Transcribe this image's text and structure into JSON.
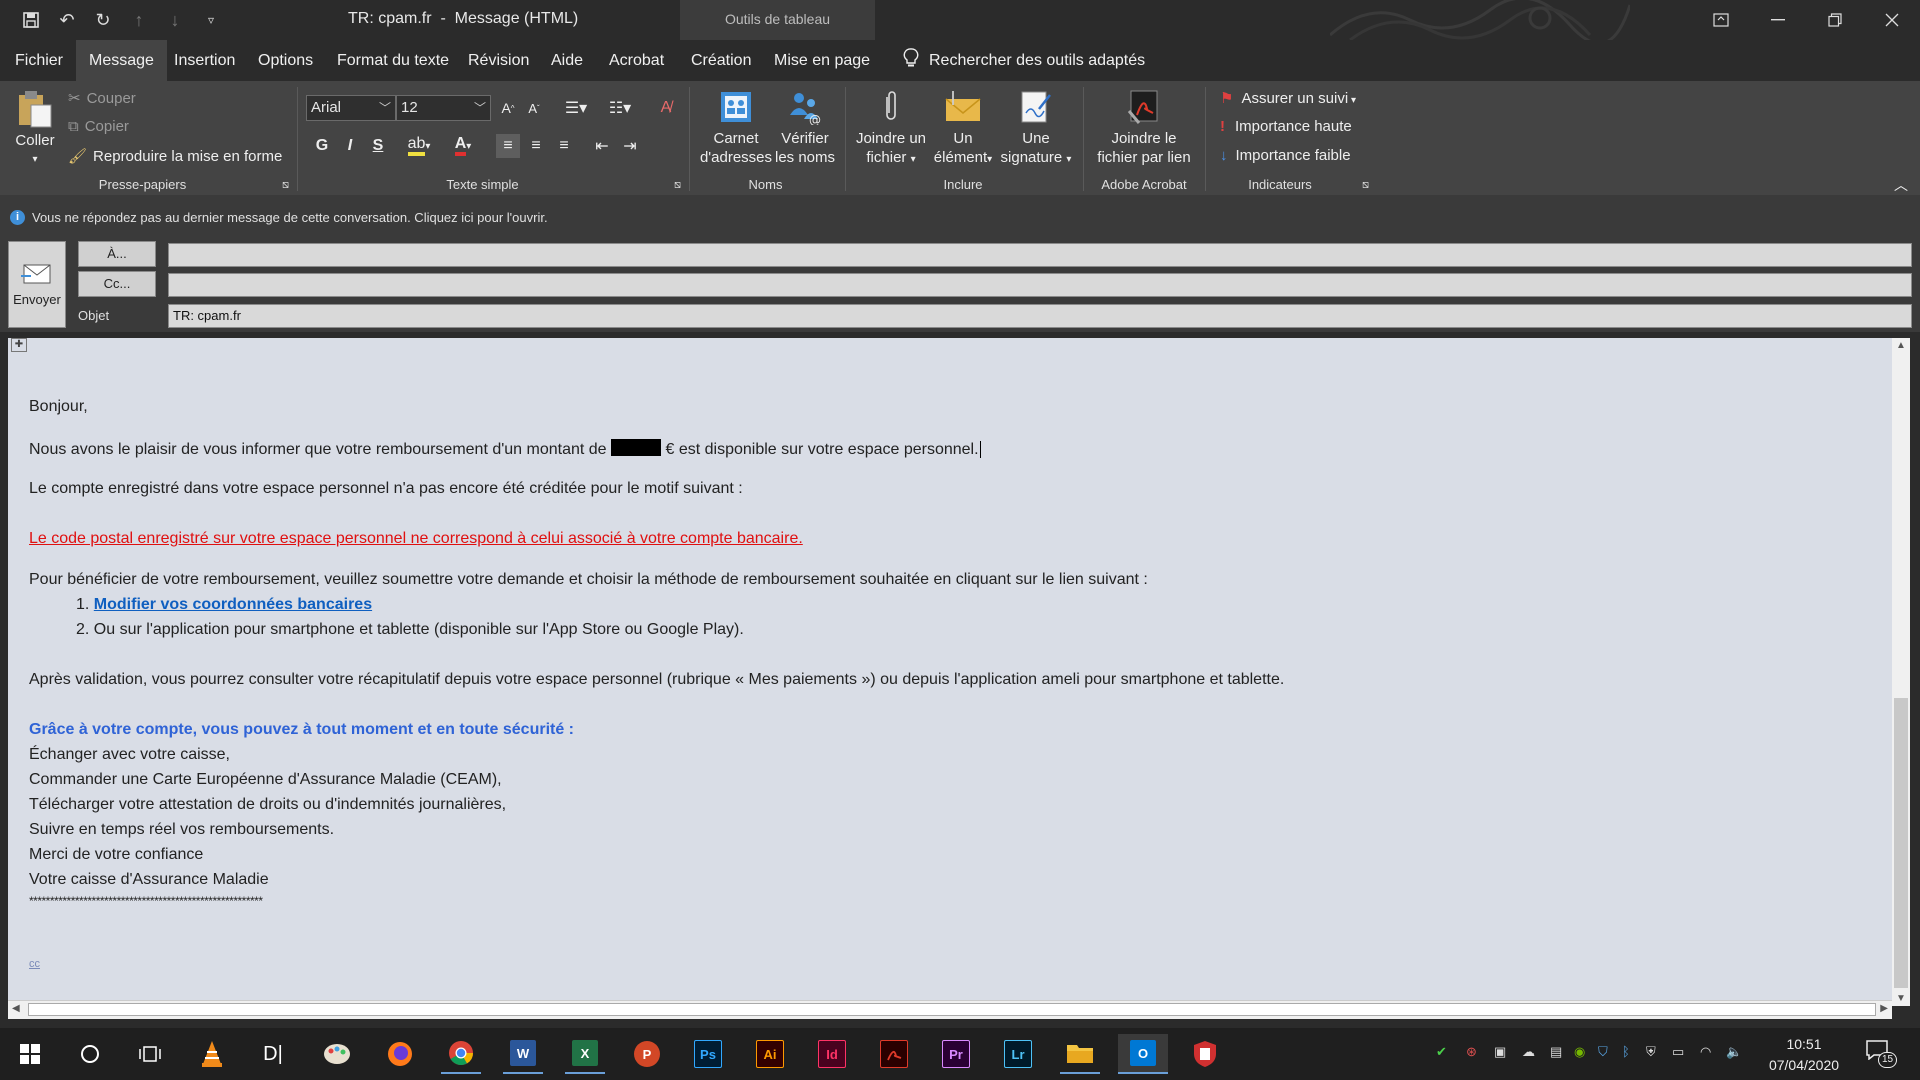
{
  "window": {
    "title": "TR: cpam.fr  -  Message (HTML)",
    "context_tab": "Outils de tableau"
  },
  "tabs": [
    {
      "label": "Fichier"
    },
    {
      "label": "Message"
    },
    {
      "label": "Insertion"
    },
    {
      "label": "Options"
    },
    {
      "label": "Format du texte"
    },
    {
      "label": "Révision"
    },
    {
      "label": "Aide"
    },
    {
      "label": "Acrobat"
    },
    {
      "label": "Création"
    },
    {
      "label": "Mise en page"
    }
  ],
  "search_tools": "Rechercher des outils adaptés",
  "ribbon": {
    "clipboard": {
      "paste": "Coller",
      "cut": "Couper",
      "copy": "Copier",
      "format_painter": "Reproduire la mise en forme",
      "group": "Presse-papiers"
    },
    "basic_text": {
      "font": "Arial",
      "size": "12",
      "bold": "G",
      "italic": "I",
      "underline": "S",
      "group": "Texte simple"
    },
    "names": {
      "address_book": "Carnet d'adresses",
      "address_book_l1": "Carnet",
      "address_book_l2": "d'adresses",
      "check_names_l1": "Vérifier",
      "check_names_l2": "les noms",
      "group": "Noms"
    },
    "include": {
      "attach_l1": "Joindre un",
      "attach_l2": "fichier",
      "item_l1": "Un",
      "item_l2": "élément",
      "signature_l1": "Une",
      "signature_l2": "signature",
      "group": "Inclure"
    },
    "acrobat": {
      "attach_link_l1": "Joindre le",
      "attach_link_l2": "fichier par lien",
      "group": "Adobe Acrobat"
    },
    "tags": {
      "follow_up": "Assurer un suivi",
      "high": "Importance haute",
      "low": "Importance faible",
      "group": "Indicateurs"
    }
  },
  "info_bar": "Vous ne répondez pas au dernier message de cette conversation. Cliquez ici pour l'ouvrir.",
  "headers": {
    "send": "Envoyer",
    "to_button": "À...",
    "cc_button": "Cc...",
    "subject_label": "Objet",
    "to_value": "",
    "cc_value": "",
    "subject_value": "TR: cpam.fr"
  },
  "body": {
    "greeting": "Bonjour,",
    "line1_a": "Nous avons le plaisir de vous informer que votre remboursement d'un montant de ",
    "line1_b": " € est disponible sur votre espace personnel.",
    "line2": "Le compte enregistré dans votre espace personnel n'a pas encore été créditée pour le motif suivant :",
    "warning": "Le code postal enregistré sur votre espace personnel ne correspond à celui associé à votre compte bancaire.",
    "line3": "Pour bénéficier de votre remboursement, veuillez soumettre votre demande et choisir la méthode de remboursement souhaitée en cliquant sur le lien suivant :",
    "list_item1_num": "1.",
    "list_item1": "Modifier vos coordonnées bancaires",
    "list_item2_num": "2.",
    "list_item2": "Ou sur l'application pour smartphone et tablette (disponible sur l'App Store ou Google Play).",
    "line4": "Après validation, vous pourrez consulter votre récapitulatif depuis votre espace personnel (rubrique « Mes paiements ») ou depuis l'application ameli pour smartphone et tablette.",
    "heading": "Grâce à votre compte, vous pouvez à tout moment et en toute sécurité :",
    "b1": "Échanger avec votre caisse,",
    "b2": "Commander une Carte Européenne d'Assurance Maladie (CEAM),",
    "b3": "Télécharger votre attestation de droits ou d'indemnités journalières,",
    "b4": "Suivre en temps réel vos remboursements.",
    "thanks": "Merci de votre confiance",
    "sign": "Votre caisse d'Assurance Maladie",
    "stars": "********************************************************",
    "footer_link": "cc"
  },
  "taskbar": {
    "apps": [
      {
        "name": "vlc",
        "label": ""
      },
      {
        "name": "dl",
        "label": "D|"
      },
      {
        "name": "firefox",
        "label": ""
      },
      {
        "name": "chrome",
        "label": ""
      },
      {
        "name": "word",
        "label": "W"
      },
      {
        "name": "excel",
        "label": "X"
      },
      {
        "name": "powerpoint",
        "label": "P"
      },
      {
        "name": "photoshop",
        "label": "Ps"
      },
      {
        "name": "illustrator",
        "label": "Ai"
      },
      {
        "name": "indesign",
        "label": "Id"
      },
      {
        "name": "acrobat",
        "label": ""
      },
      {
        "name": "premiere",
        "label": "Pr"
      },
      {
        "name": "lightroom",
        "label": "Lr"
      },
      {
        "name": "explorer",
        "label": ""
      },
      {
        "name": "outlook",
        "label": "O"
      },
      {
        "name": "security",
        "label": ""
      }
    ],
    "time": "10:51",
    "date": "07/04/2020",
    "notifications": "15"
  },
  "colors": {
    "warning_red": "#e01010",
    "link_blue": "#0f5fc0",
    "heading_blue": "#2f63d6",
    "body_bg": "#d9dde6"
  }
}
